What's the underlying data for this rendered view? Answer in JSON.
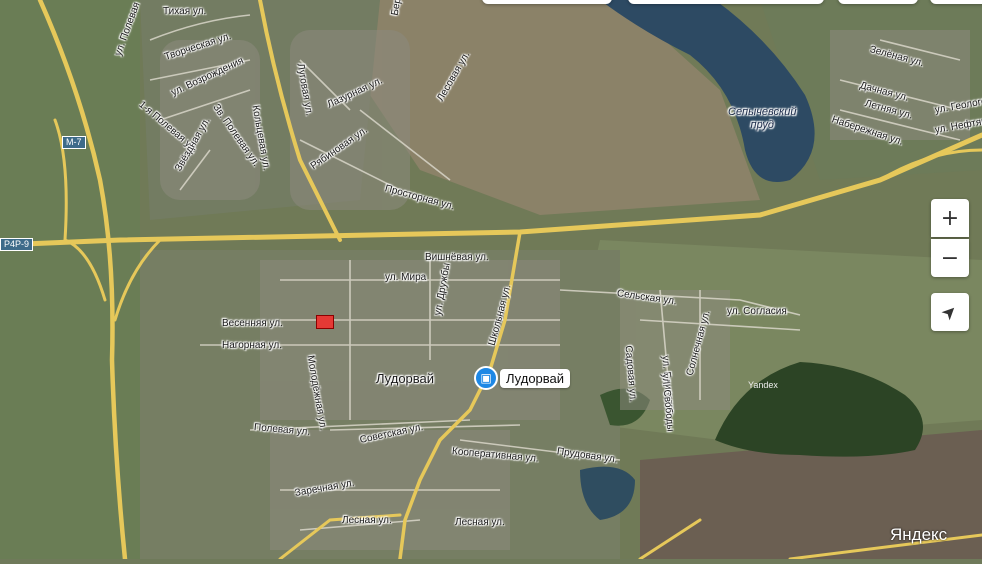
{
  "map": {
    "place_name": "Лудорвай",
    "marker_label": "Лудорвай",
    "water_label": "Сепычевский\nпруд",
    "brand": "Яндекс",
    "small_brand": "Yandex",
    "road_shields": [
      "М-7",
      "Р4Р-9"
    ],
    "streets": [
      "Тихая ул.",
      "ул. Полевая",
      "Творческая ул.",
      "ул. Возрождения",
      "1-я Полевая ул.",
      "Зв. Полевая ул.",
      "Звёздная ул.",
      "Кольцевая ул.",
      "Кольцевая ул.",
      "Берёзовая ул.",
      "Луговая ул.",
      "Лазурная ул.",
      "Лесовая ул.",
      "Рябиновая ул.",
      "Просторная ул.",
      "Вишнёвая ул.",
      "ул. Мира",
      "ул. Дружбы",
      "Школьная ул.",
      "Весенняя ул.",
      "Нагорная ул.",
      "Молодёжная ул.",
      "Сельская ул.",
      "ул. Согласия",
      "Садовая ул.",
      "ул. Единства",
      "ул. Свободы",
      "Солнечная ул.",
      "Полевая ул.",
      "Советская ул.",
      "Кооперативная ул.",
      "Прудовая ул.",
      "Заречная ул.",
      "Лесная ул.",
      "Лесная ул.",
      "Зелёная ул.",
      "Дачная ул.",
      "Летняя ул.",
      "Набережная ул.",
      "ул. Геологов",
      "ул. Нефтяников"
    ]
  },
  "controls": {
    "zoom_in": "+",
    "zoom_out": "−",
    "locate": "➤"
  }
}
